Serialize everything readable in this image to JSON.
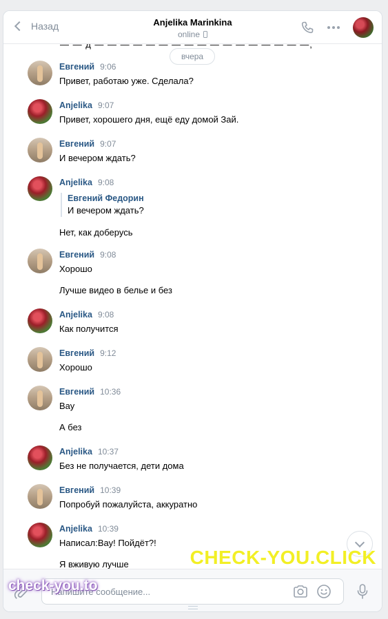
{
  "header": {
    "back_label": "Назад",
    "contact_name": "Anjelika Marinkina",
    "status": "online"
  },
  "date_divider": "вчера",
  "messages": [
    {
      "author": "Евгений",
      "time": "9:06",
      "avatar": "evgeny",
      "texts": [
        "Привет, работаю уже. Сделала?"
      ]
    },
    {
      "author": "Anjelika",
      "time": "9:07",
      "avatar": "anjelika",
      "texts": [
        "Привет, хорошего дня, ещё еду домой Зай."
      ]
    },
    {
      "author": "Евгений",
      "time": "9:07",
      "avatar": "evgeny",
      "texts": [
        "И вечером ждать?"
      ]
    },
    {
      "author": "Anjelika",
      "time": "9:08",
      "avatar": "anjelika",
      "forward": {
        "author": "Евгений Федорин",
        "text": "И вечером ждать?"
      },
      "texts": [
        "Нет, как доберусь"
      ]
    },
    {
      "author": "Евгений",
      "time": "9:08",
      "avatar": "evgeny",
      "texts": [
        "Хорошо",
        "Лучше видео в белье и без"
      ]
    },
    {
      "author": "Anjelika",
      "time": "9:08",
      "avatar": "anjelika",
      "texts": [
        "Как получится"
      ]
    },
    {
      "author": "Евгений",
      "time": "9:12",
      "avatar": "evgeny",
      "texts": [
        "Хорошо"
      ]
    },
    {
      "author": "Евгений",
      "time": "10:36",
      "avatar": "evgeny",
      "texts": [
        "Вау",
        "А без"
      ]
    },
    {
      "author": "Anjelika",
      "time": "10:37",
      "avatar": "anjelika",
      "texts": [
        "Без не получается, дети дома"
      ]
    },
    {
      "author": "Евгений",
      "time": "10:39",
      "avatar": "evgeny",
      "texts": [
        "Попробуй пожалуйста, аккуратно"
      ]
    },
    {
      "author": "Anjelika",
      "time": "10:39",
      "avatar": "anjelika",
      "texts": [
        "Написал:Вау! Пойдёт?!",
        "Я вживую лучше"
      ]
    }
  ],
  "composer": {
    "placeholder": "Напишите сообщение..."
  },
  "watermarks": {
    "large": "CHECK-YOU.CLICK",
    "small": "check-you.to"
  },
  "colors": {
    "author": "#2a5885",
    "muted": "#818c99",
    "watermark_large": "#f2ef25"
  }
}
